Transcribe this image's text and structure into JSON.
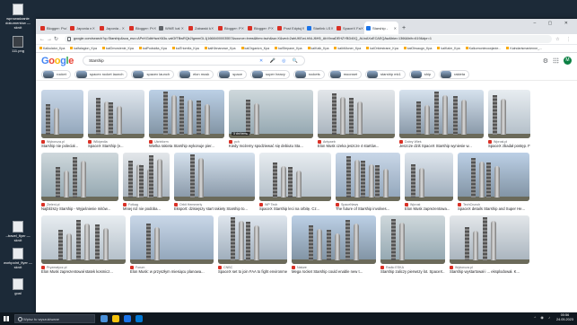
{
  "desktop": {
    "icons": [
      {
        "label": "wprowadzanie dokumentów — skrót",
        "dark": false
      },
      {
        "label": "111.png",
        "dark": true
      },
      {
        "label": "--travel_flyer — skrót",
        "dark": false
      },
      {
        "label": "workpoint_flyer — skrót",
        "dark": false
      },
      {
        "label": "goal",
        "dark": false
      }
    ]
  },
  "browser": {
    "tabs": [
      {
        "label": "Blogger: Prz",
        "fav": "red"
      },
      {
        "label": "Japonia n",
        "fav": "red"
      },
      {
        "label": "Japonia -",
        "fav": "red"
      },
      {
        "label": "Blogger: Pr",
        "fav": "red"
      },
      {
        "label": "WWE kal",
        "fav": "gray"
      },
      {
        "label": "Zabawki k",
        "fav": "red"
      },
      {
        "label": "Blogger: P",
        "fav": "red"
      },
      {
        "label": "Blogger: P",
        "fav": "red"
      },
      {
        "label": "Post Edytuj",
        "fav": "red"
      },
      {
        "label": "Starlink LS",
        "fav": "blue"
      },
      {
        "label": "SpaceX Fa",
        "fav": "red"
      },
      {
        "label": "Starship -",
        "fav": "blue",
        "active": true
      }
    ],
    "url": "google.com/search?q=Starship&sca_esv=APeXGdbHwzX63u-valGfTBwRQk2IgmmGL1j1668400003557&source=lnms&tbm=isch&sa=X&ved=2ahUKEwi-hNLJ6H5_AhXhxaDEHZYBD40Q_AUoAXoECAEQAw&biw=1366&bih=619&dpr=1",
    "bookmarks": [
      "Kalkulator_Kpa",
      "kalfalagion_Kpa",
      "kalOmowienie_Kpa",
      "kalPodsidta_Kpa",
      "kalTriomfia_Kpa",
      "kalKibnanowe_Kpa",
      "kalOrganizn_Kpa",
      "kalStepane_Kpa",
      "kalKalk_Kpa",
      "kalkMioner_Kpa",
      "kalOrkiestrane_Kpa",
      "kalObsaugn_Kpa",
      "kalKalm_Kpa",
      "Kalkomonlecowjanie...",
      "Kalndarismanienne_..."
    ]
  },
  "google": {
    "query": "Starship",
    "avatar_letter": "M",
    "chips": [
      "rocket",
      "spacex rocket launch",
      "spacex launch",
      "elon musk",
      "space",
      "super heavy",
      "rockets",
      "moonset",
      "starship mk1",
      "ship",
      "rakieta"
    ]
  },
  "results": [
    [
      {
        "source": "Wyborcza.pl",
        "title": "Starship nie poleciał...",
        "w": 48
      },
      {
        "source": "Wikipedia",
        "title": "SpaceX Starship (e...",
        "w": 65
      },
      {
        "source": "Ukrinform",
        "title": "Wielka rakieta Starship wykonuje pier...",
        "w": 86
      },
      {
        "source": "pch",
        "title": "Kiedy możemy spodziewać się debiutu Sta...",
        "w": 96,
        "badge": "3 dni temu"
      },
      {
        "source": "Antyweb",
        "title": "Elon Musk czeka jeszcze 4 startów...",
        "w": 88
      },
      {
        "source": "Dobry Wieś",
        "title": "Jeszcze dziś SpaceX Starship wyniesie w...",
        "w": 96
      },
      {
        "source": "Wprost.pl",
        "title": "SpaceX zbadał postęp. Firma Elo...",
        "w": 48
      }
    ],
    [
      {
        "source": "Zieleni.pl",
        "title": "Najbliższy Starship - Wyjaśnienie mitów...",
        "w": 92
      },
      {
        "source": "Fotkag",
        "title": "Mniej niż nie podoba...",
        "w": 56
      },
      {
        "source": "Orbit Hemmerly",
        "title": "Eksport: dzisiejszy start rakiety Starship to...",
        "w": 96
      },
      {
        "source": "WP Tech",
        "title": "SpaceX Starship leci na orbitę. Cz...",
        "w": 85
      },
      {
        "source": "SpaceNews",
        "title": "The future of Starship involves...",
        "w": 77
      },
      {
        "source": "Wprost",
        "title": "Elon Musk zaprezentowa...",
        "w": 58
      },
      {
        "source": "TechCrunch",
        "title": "SpaceX details Starship and Super He...",
        "w": 85
      }
    ],
    [
      {
        "source": "Pryzmatycz.pl",
        "title": "Elon Musk zaprezentował statek kosmicz...",
        "w": 96
      },
      {
        "source": "Forum",
        "title": "Elon Musk: w przyszłym miesiącu planowa...",
        "w": 95
      },
      {
        "source": "CNBC",
        "title": "SpaceX set to join FAA to fight environment...",
        "w": 78
      },
      {
        "source": "Nature",
        "title": "Mega rocket Starship could enable new t...",
        "w": 96
      },
      {
        "source": "Radio ESKA",
        "title": "Starship zaliczy pierwszy lot. SpaceX...",
        "w": 73
      },
      {
        "source": "Wyborcza.pl",
        "title": "Starship wystartował i ... eksplodował. K...",
        "w": 91
      }
    ]
  ],
  "taskbar": {
    "search_placeholder": "Wpisz tu wyszukiwane",
    "time": "00:56",
    "date": "24.05.2023"
  }
}
